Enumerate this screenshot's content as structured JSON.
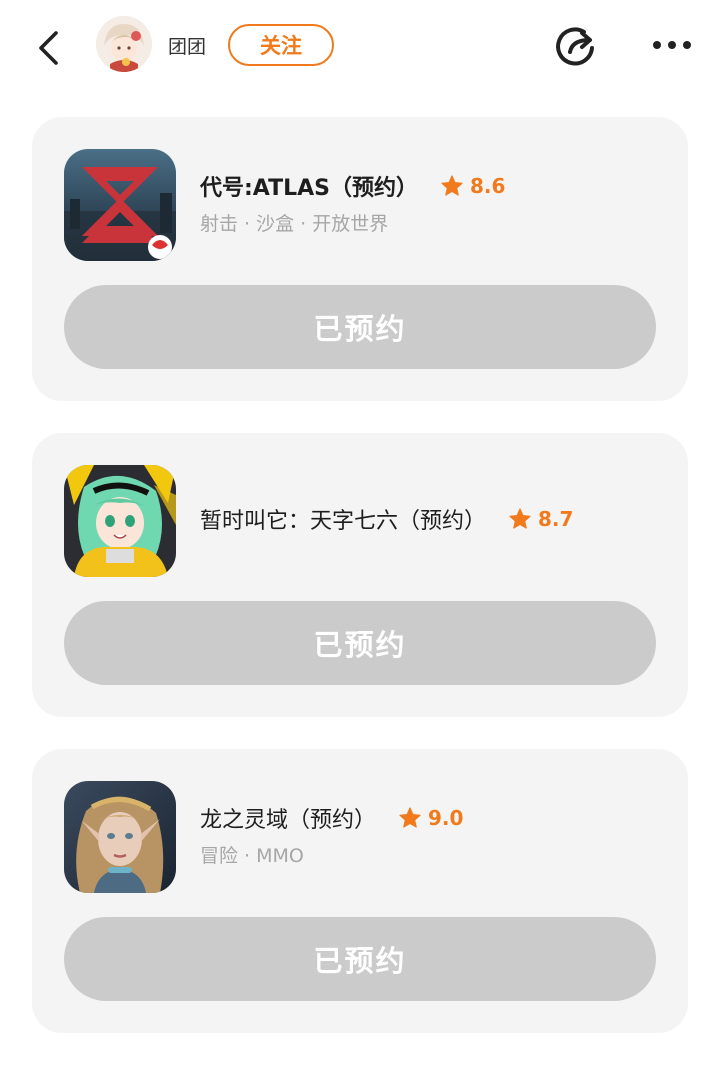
{
  "header": {
    "username": "团团",
    "follow_label": "关注",
    "icons": {
      "back": "back-arrow-icon",
      "share": "share-icon",
      "more": "more-icon"
    }
  },
  "colors": {
    "accent": "#f07a1c",
    "card_bg": "#f4f4f4",
    "reserved_btn_bg": "#cbcbcb",
    "tag_text": "#a6a6a6"
  },
  "games": [
    {
      "title": "代号:ATLAS（预约）",
      "rating": "8.6",
      "tags": "射击 · 沙盒 · 开放世界",
      "button_label": "已预约",
      "icon": "atlas-game-icon"
    },
    {
      "title": "暂时叫它：天字七六（预约）",
      "rating": "8.7",
      "tags": "",
      "button_label": "已预约",
      "icon": "anime-girl-game-icon"
    },
    {
      "title": "龙之灵域（预约）",
      "rating": "9.0",
      "tags": "冒险 · MMO",
      "button_label": "已预约",
      "icon": "elf-game-icon"
    }
  ]
}
